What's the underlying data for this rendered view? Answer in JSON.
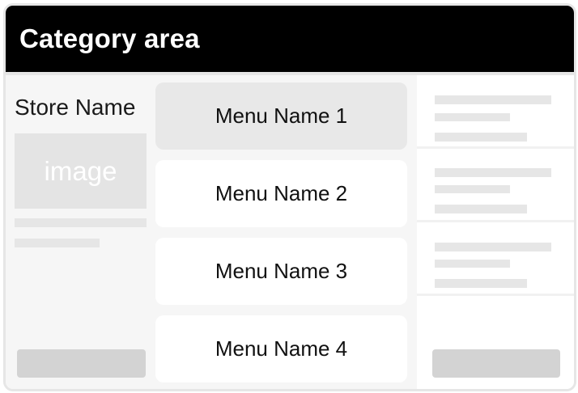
{
  "header": {
    "title": "Category area"
  },
  "store": {
    "name": "Store Name",
    "image_placeholder": "image"
  },
  "menu": {
    "items": [
      {
        "label": "Menu Name 1",
        "selected": true
      },
      {
        "label": "Menu Name 2",
        "selected": false
      },
      {
        "label": "Menu Name 3",
        "selected": false
      },
      {
        "label": "Menu Name 4",
        "selected": false
      }
    ]
  },
  "colors": {
    "header_background": "#000000",
    "header_text": "#ffffff",
    "selected_menu_background": "#e8e8e8",
    "placeholder_gray": "#e6e6e6",
    "button_gray": "#d3d3d3"
  }
}
